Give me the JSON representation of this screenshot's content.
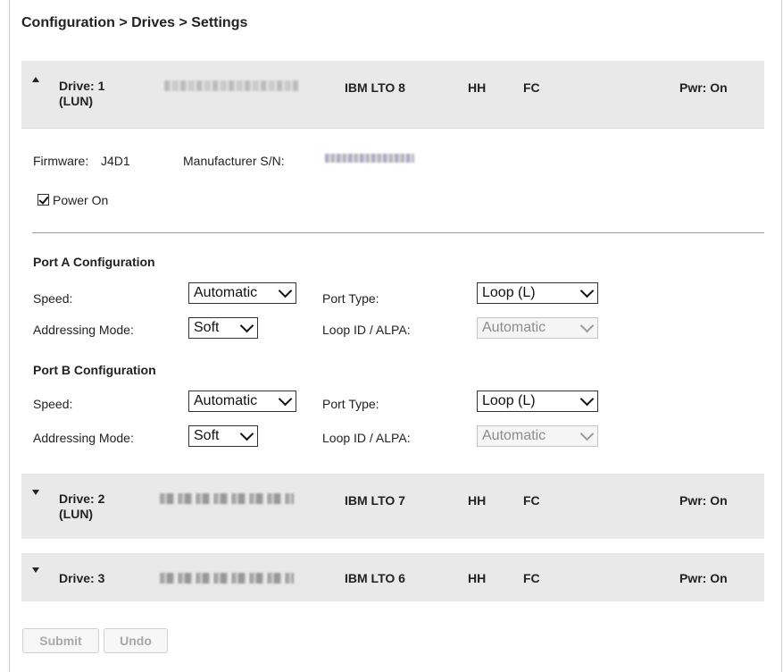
{
  "breadcrumb": "Configuration > Drives > Settings",
  "drives": [
    {
      "name": "Drive: 1",
      "lun": "(LUN)",
      "model": "IBM LTO 8",
      "form": "HH",
      "iface": "FC",
      "power": "Pwr: On",
      "expanded": true
    },
    {
      "name": "Drive: 2",
      "lun": "(LUN)",
      "model": "IBM LTO 7",
      "form": "HH",
      "iface": "FC",
      "power": "Pwr: On",
      "expanded": false
    },
    {
      "name": "Drive: 3",
      "lun": "",
      "model": "IBM LTO 6",
      "form": "HH",
      "iface": "FC",
      "power": "Pwr: On",
      "expanded": false
    }
  ],
  "details": {
    "firmware_label": "Firmware:",
    "firmware_value": "J4D1",
    "manufacturer_sn_label": "Manufacturer S/N:",
    "power_on_label": "Power On",
    "power_on_checked": true
  },
  "port_a": {
    "title": "Port A Configuration",
    "speed_label": "Speed:",
    "speed_value": "Automatic",
    "port_type_label": "Port Type:",
    "port_type_value": "Loop (L)",
    "addressing_label": "Addressing Mode:",
    "addressing_value": "Soft",
    "loop_id_label": "Loop ID / ALPA:",
    "loop_id_value": "Automatic"
  },
  "port_b": {
    "title": "Port B Configuration",
    "speed_label": "Speed:",
    "speed_value": "Automatic",
    "port_type_label": "Port Type:",
    "port_type_value": "Loop (L)",
    "addressing_label": "Addressing Mode:",
    "addressing_value": "Soft",
    "loop_id_label": "Loop ID / ALPA:",
    "loop_id_value": "Automatic"
  },
  "buttons": {
    "submit": "Submit",
    "undo": "Undo"
  },
  "icons": {
    "expanded": "chevron-up-icon",
    "collapsed": "chevron-down-icon",
    "checkbox": "checkmark-icon"
  },
  "colors": {
    "header_bg": "#e9e9e9",
    "divider": "#9a9a9a",
    "disabled_text": "#a8a8a8"
  }
}
